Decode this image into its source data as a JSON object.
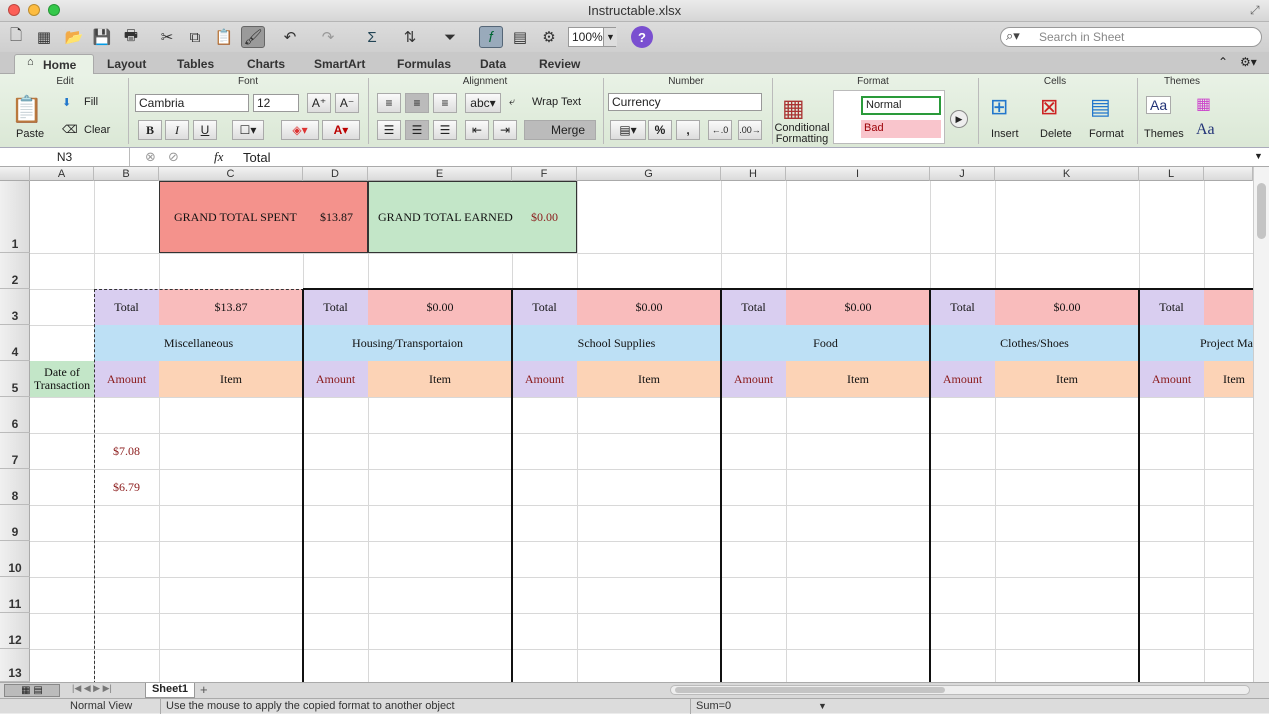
{
  "window": {
    "title": "Instructable.xlsx"
  },
  "toolbar": {
    "zoom": "100%",
    "search_placeholder": "Search in Sheet"
  },
  "tabs": [
    "Home",
    "Layout",
    "Tables",
    "Charts",
    "SmartArt",
    "Formulas",
    "Data",
    "Review"
  ],
  "ribbon": {
    "groups": {
      "edit": "Edit",
      "font": "Font",
      "alignment": "Alignment",
      "number": "Number",
      "format": "Format",
      "cells": "Cells",
      "themes": "Themes"
    },
    "paste": "Paste",
    "fill": "Fill",
    "clear": "Clear",
    "font_name": "Cambria",
    "font_size": "12",
    "bold": "B",
    "italic": "I",
    "underline": "U",
    "wrap_text": "Wrap Text",
    "merge": "Merge",
    "abc": "abc",
    "number_format": "Currency",
    "percent": "%",
    "comma": ",",
    "conditional_formatting": "Conditional Formatting",
    "style_normal": "Normal",
    "style_bad": "Bad",
    "insert": "Insert",
    "delete": "Delete",
    "format": "Format",
    "themes": "Themes",
    "aa": "Aa"
  },
  "formula_bar": {
    "cell_ref": "N3",
    "fx": "fx",
    "content": "Total"
  },
  "columns": [
    "A",
    "B",
    "C",
    "D",
    "E",
    "F",
    "G",
    "H",
    "I",
    "J",
    "K",
    "L"
  ],
  "rows": [
    "1",
    "2",
    "3",
    "4",
    "5",
    "6",
    "7",
    "8",
    "9",
    "10",
    "11",
    "12",
    "13"
  ],
  "cells": {
    "grand_total_spent_label": "GRAND TOTAL SPENT",
    "grand_total_spent": "$13.87",
    "grand_total_earned_label": "GRAND TOTAL EARNED",
    "grand_total_earned": "$0.00",
    "date_of_transaction": "Date of Transaction",
    "total_label": "Total",
    "amount_label": "Amount",
    "item_label": "Item",
    "categories": [
      {
        "name": "Miscellaneous",
        "total": "$13.87"
      },
      {
        "name": "Housing/Transportaion",
        "total": "$0.00"
      },
      {
        "name": "School Supplies",
        "total": "$0.00"
      },
      {
        "name": "Food",
        "total": "$0.00"
      },
      {
        "name": "Clothes/Shoes",
        "total": "$0.00"
      },
      {
        "name": "Project Ma",
        "total": ""
      }
    ],
    "b7": "$7.08",
    "b8": "$6.79"
  },
  "sheet_tabs": {
    "active": "Sheet1",
    "add": "+"
  },
  "status": {
    "view": "Normal View",
    "message": "Use the mouse to apply the copied format to another object",
    "sum": "Sum=0"
  },
  "colors": {
    "red_fill": "#f4928c",
    "green_fill": "#c3e6c8",
    "purple_fill": "#d9cef0",
    "pink_fill": "#f9bcbc",
    "blue_fill": "#bde0f5",
    "peach_fill": "#fcd3b6",
    "amount_text": "#8b1a1a"
  }
}
